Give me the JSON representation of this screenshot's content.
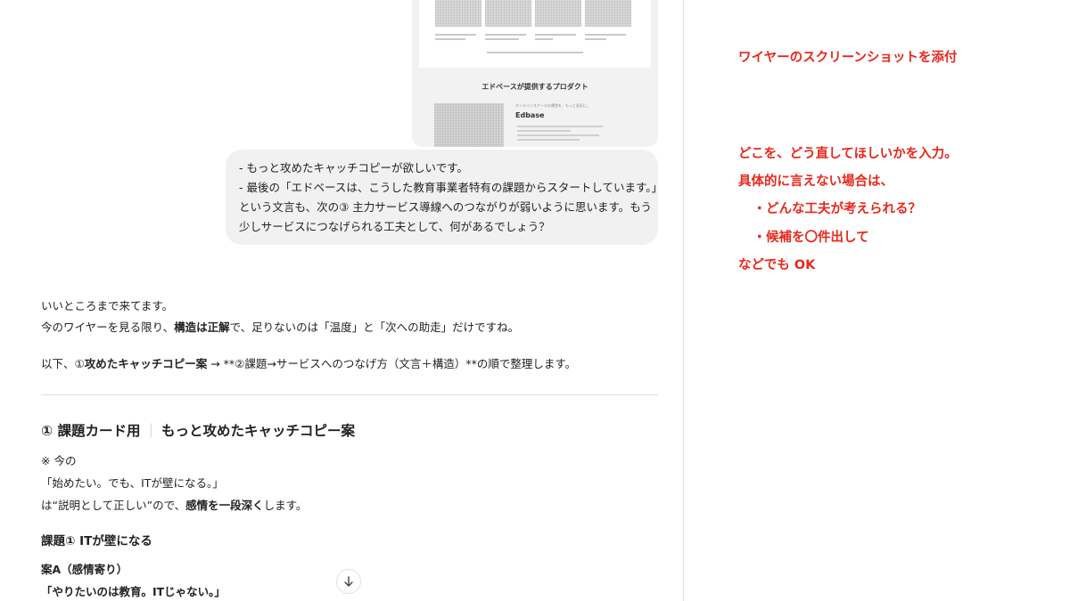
{
  "attachment": {
    "heading": "エドベースが提供するプロダクト",
    "product_name": "Edbase",
    "product_kicker": "オンラインスクールの運営を、もっと身近に。"
  },
  "user_message": {
    "lines": [
      "- もっと攻めたキャッチコピーが欲しいです。",
      "- 最後の「エドベースは、こうした教育事業者特有の課題からスタートしています。」",
      "という文言も、次の③ 主力サービス導線へのつながりが弱いように思います。もう",
      "少しサービスにつなげられる工夫として、何があるでしょう？"
    ]
  },
  "response": {
    "intro_1": "いいところまで来てます。",
    "intro_2_a": "今のワイヤーを見る限り、",
    "intro_2_b": "構造は正解",
    "intro_2_c": "で、足りないのは「温度」と「次への助走」だけですね。",
    "plan_a": "以下、①",
    "plan_b": "攻めたキャッチコピー案",
    "plan_c": " → **②課題→サービスへのつなげ方（文言＋構造）**の順で整理します。",
    "section_title_a": "① 課題カード用",
    "section_sep": "｜",
    "section_title_b": "もっと攻めたキャッチコピー案",
    "note_1": "※ 今の",
    "note_2": "「始めたい。でも、ITが壁になる。」",
    "note_3_a": "は“説明として正しい”ので、",
    "note_3_b": "感情を一段深く",
    "note_3_c": "します。",
    "issue_title": "課題① ITが壁になる",
    "plan_label": "案A（感情寄り）",
    "plan_copy": "「やりたいのは教育。ITじゃない。」"
  },
  "annotations": {
    "attach_note": "ワイヤーのスクリーンショットを添付",
    "input_lines": [
      "どこを、どう直してほしいかを入力。",
      "具体的に言えない場合は、",
      "　・どんな工夫が考えられる？",
      "　・候補を〇件出して",
      "などでも OK"
    ]
  },
  "colors": {
    "annotation": "#e8281c",
    "bubble_bg": "#f1f1f1"
  },
  "icons": {
    "scroll_down": "arrow-down-icon"
  }
}
